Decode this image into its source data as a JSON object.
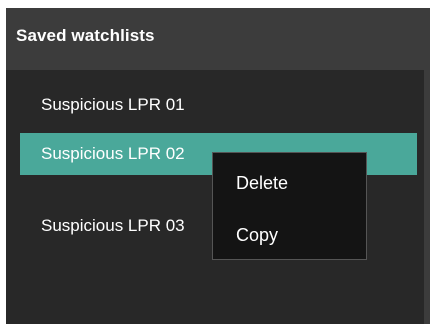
{
  "panel": {
    "title": "Saved watchlists",
    "items": [
      {
        "label": "Suspicious LPR 01",
        "selected": false
      },
      {
        "label": "Suspicious LPR 02",
        "selected": true
      },
      {
        "label": "Suspicious LPR 03",
        "selected": false
      }
    ]
  },
  "context_menu": {
    "items": [
      {
        "label": "Delete"
      },
      {
        "label": "Copy"
      }
    ]
  },
  "colors": {
    "panel_bg": "#3c3c3c",
    "list_bg": "#282828",
    "selected_bg": "#4aa89a",
    "menu_bg": "#141414",
    "text": "#ffffff"
  }
}
